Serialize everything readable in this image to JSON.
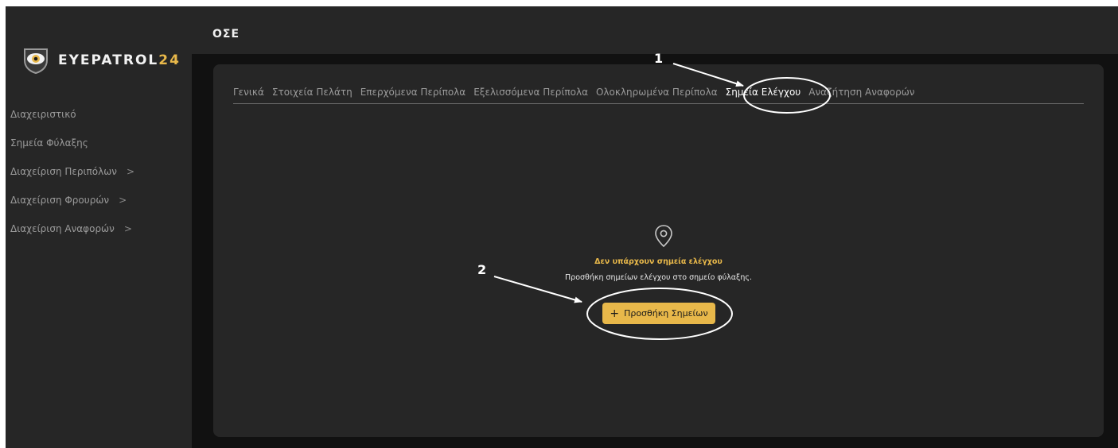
{
  "brand": {
    "name_main": "EYEPATROL",
    "name_accent": "24"
  },
  "header": {
    "title": "ΟΣΕ"
  },
  "sidebar": {
    "items": [
      {
        "label": "Διαχειριστικό",
        "chevron": ""
      },
      {
        "label": "Σημεία Φύλαξης",
        "chevron": ""
      },
      {
        "label": "Διαχείριση Περιπόλων",
        "chevron": ">"
      },
      {
        "label": "Διαχείριση Φρουρών",
        "chevron": ">"
      },
      {
        "label": "Διαχείριση Αναφορών",
        "chevron": ">"
      }
    ]
  },
  "tabs": [
    {
      "label": "Γενικά"
    },
    {
      "label": "Στοιχεία Πελάτη"
    },
    {
      "label": "Επερχόμενα Περίπολα"
    },
    {
      "label": "Εξελισσόμενα Περίπολα"
    },
    {
      "label": "Ολοκληρωμένα Περίπολα"
    },
    {
      "label": "Σημεία Ελέγχου"
    },
    {
      "label": "Αναζήτηση Αναφορών"
    }
  ],
  "active_tab": "Σημεία Ελέγχου",
  "empty_state": {
    "icon": "map-pin-icon",
    "title": "Δεν υπάρχουν σημεία ελέγχου",
    "subtitle": "Προσθήκη σημείων ελέγχου στο σημείο φύλαξης.",
    "button_label": "Προσθήκη Σημείων",
    "button_icon": "+"
  },
  "annotations": {
    "label_1": "1",
    "label_2": "2"
  },
  "colors": {
    "accent": "#e8b84a",
    "background": "#111111",
    "panel": "#262626",
    "annotation": "#ffffff"
  }
}
